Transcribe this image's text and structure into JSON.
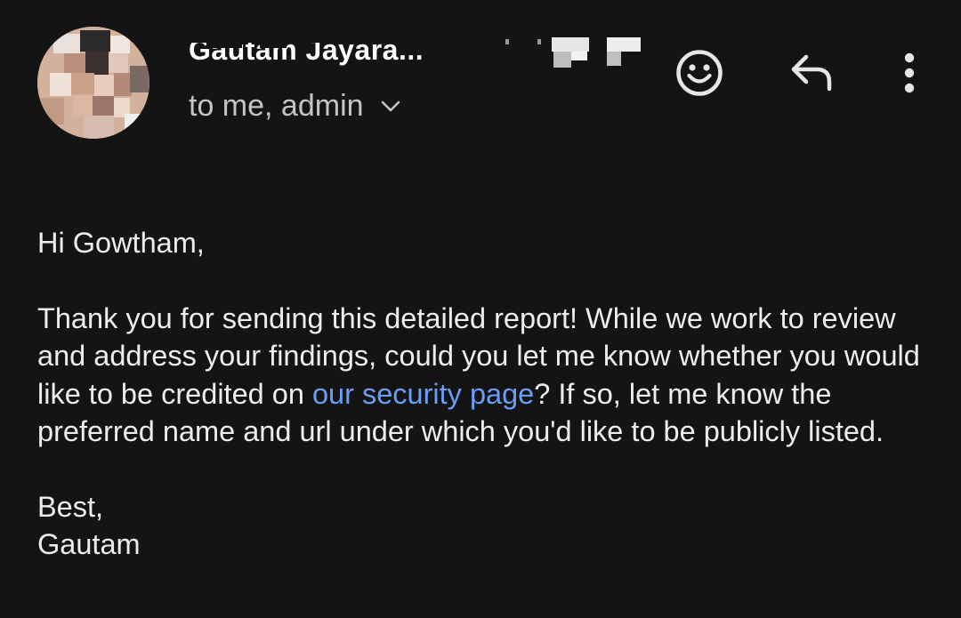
{
  "header": {
    "sender_name": "Gautam Jayara...",
    "recipients": "to me, admin",
    "expand_icon": "chevron-down-icon",
    "actions": [
      {
        "icon": "emoji-reaction-icon"
      },
      {
        "icon": "reply-icon"
      },
      {
        "icon": "more-vert-icon"
      }
    ]
  },
  "email": {
    "greeting": "Hi Gowtham,",
    "body_before_link": "Thank you for sending this detailed report! While we work to review and address your findings, could you let me know whether you would like to be credited on ",
    "link_text": "our security page",
    "body_after_link": "? If so, let me know the preferred name and url under which you'd like to be publicly listed.",
    "signoff": "Best,",
    "signature": "Gautam"
  },
  "colors": {
    "background": "#141414",
    "text": "#ededed",
    "secondary_text": "#c4c4c4",
    "link": "#6a9ef5"
  }
}
